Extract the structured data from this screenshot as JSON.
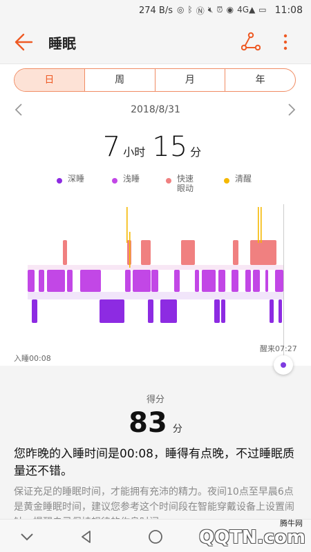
{
  "status": {
    "speed": "274 B/s",
    "network": "4G",
    "time": "11:08"
  },
  "app": {
    "title": "睡眠"
  },
  "tabs": [
    "日",
    "周",
    "月",
    "年"
  ],
  "date": "2018/8/31",
  "duration": {
    "hours": "7",
    "hours_unit": "小时",
    "minutes": "15",
    "minutes_unit": "分"
  },
  "legend": [
    {
      "label": "深睡",
      "color": "#8d2be2"
    },
    {
      "label": "浅睡",
      "color": "#c247e6"
    },
    {
      "label": "快速眼动",
      "color": "#f08080"
    },
    {
      "label": "清醒",
      "color": "#f5b800"
    }
  ],
  "chart": {
    "start_label": "入睡00:08",
    "end_label": "醒来07:27"
  },
  "score": {
    "label": "得分",
    "value": "83",
    "unit": "分"
  },
  "summary": "您昨晚的入睡时间是00:08，睡得有点晚，不过睡眠质量还不错。",
  "description": "保证充足的睡眠时间，才能拥有充沛的精力。夜间10点至早晨6点是黄金睡眠时间，建议您参考这个时间段在智能穿戴设备上设置闹钟，提醒自己保持规律的作息时间。",
  "watermark": {
    "text": "腾牛网",
    "logo": "QQTN.com"
  }
}
